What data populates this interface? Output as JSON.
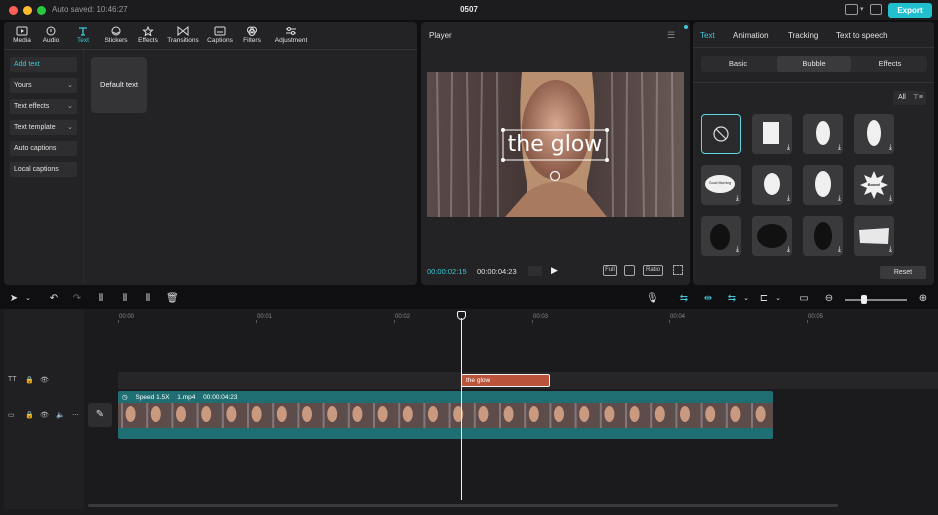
{
  "window": {
    "autosaved": "Auto saved: 10:46:27",
    "project_title": "0507",
    "export_label": "Export",
    "traffic_colors": [
      "#fe5f57",
      "#febc2e",
      "#28c840"
    ]
  },
  "media_tabs": [
    {
      "label": "Media",
      "icon": "media-icon"
    },
    {
      "label": "Audio",
      "icon": "audio-icon"
    },
    {
      "label": "Text",
      "icon": "text-icon",
      "active": true
    },
    {
      "label": "Stickers",
      "icon": "stickers-icon"
    },
    {
      "label": "Effects",
      "icon": "effects-icon"
    },
    {
      "label": "Transitions",
      "icon": "transitions-icon"
    },
    {
      "label": "Captions",
      "icon": "captions-icon"
    },
    {
      "label": "Filters",
      "icon": "filters-icon"
    },
    {
      "label": "Adjustment",
      "icon": "adjustment-icon"
    }
  ],
  "text_sidebar": [
    {
      "label": "Add text",
      "active": true
    },
    {
      "label": "Yours",
      "chevron": true
    },
    {
      "label": "Text effects",
      "chevron": true
    },
    {
      "label": "Text template",
      "chevron": true
    },
    {
      "label": "Auto captions"
    },
    {
      "label": "Local captions"
    }
  ],
  "default_text_card": "Default text",
  "player": {
    "title": "Player",
    "overlay_text": "the glow",
    "current_time": "00:00:02:15",
    "total_time": "00:00:04:23",
    "full_label": "Full",
    "ratio_label": "Ratio"
  },
  "properties": {
    "tabs": [
      "Text",
      "Animation",
      "Tracking",
      "Text to speech"
    ],
    "active_tab": "Text",
    "subtabs": [
      "Basic",
      "Bubble",
      "Effects"
    ],
    "active_subtab": "Bubble",
    "filter_label": "All",
    "reset_label": "Reset",
    "bubble_labels": {
      "b5": "Good Morning",
      "b8": "Boom!"
    }
  },
  "timeline": {
    "ruler": [
      "00:00",
      "00:01",
      "00:02",
      "00:03",
      "00:04",
      "00:05"
    ],
    "text_clip_label": "the glow",
    "video_clip": {
      "speed": "Speed 1.5X",
      "file": "1.mp4",
      "duration": "00:00:04:23"
    }
  },
  "colors": {
    "accent": "#3ec7d6",
    "export": "#22c0cf",
    "text_clip": "#b9533a",
    "video_clip": "#1e6e72"
  }
}
